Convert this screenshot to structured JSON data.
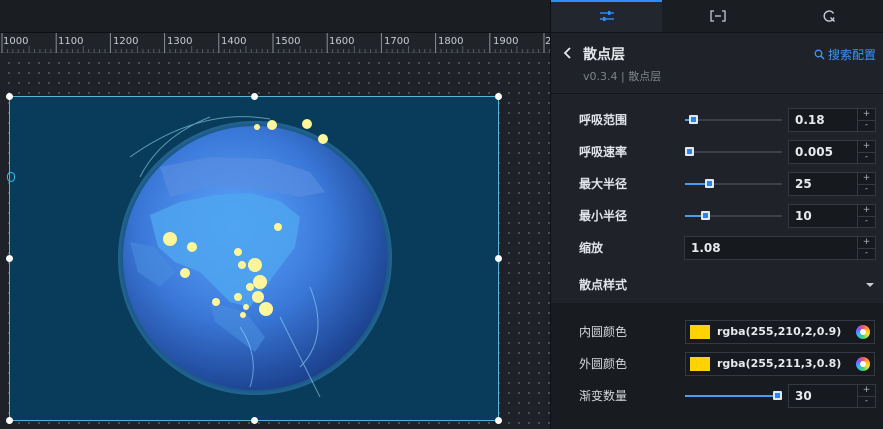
{
  "ruler": {
    "labels": [
      "1000",
      "1100",
      "1200",
      "1300",
      "1400",
      "1500",
      "1600",
      "1700",
      "1800",
      "1900",
      "2"
    ]
  },
  "tabs": [
    {
      "icon": "sliders-icon"
    },
    {
      "icon": "bracket-icon"
    },
    {
      "icon": "refresh-icon"
    }
  ],
  "panel": {
    "title": "散点层",
    "version": "v0.3.4 | 散点层",
    "search_label": "搜索配置",
    "section_label": "散点样式"
  },
  "settings": {
    "breath_range": {
      "label": "呼吸范围",
      "value": "0.18",
      "level": 0.05
    },
    "breath_speed": {
      "label": "呼吸速率",
      "value": "0.005",
      "level": 0.0
    },
    "max_radius": {
      "label": "最大半径",
      "value": "25",
      "level": 0.23
    },
    "min_radius": {
      "label": "最小半径",
      "value": "10",
      "level": 0.18
    },
    "zoom": {
      "label": "缩放",
      "value": "1.08"
    }
  },
  "style": {
    "inner_color": {
      "label": "内圆颜色",
      "value": "rgba(255,210,2,0.9)",
      "swatch": "#ffd202"
    },
    "outer_color": {
      "label": "外圆颜色",
      "value": "rgba(255,211,3,0.8)",
      "swatch": "#ffd303"
    },
    "gradient_count": {
      "label": "渐变数量",
      "value": "30",
      "level": 1.0
    }
  },
  "colors": {
    "accent": "#2f8cff",
    "canvas_bg": "#083c5a",
    "globe": "#3a7fe0",
    "point": "#fff59a"
  }
}
